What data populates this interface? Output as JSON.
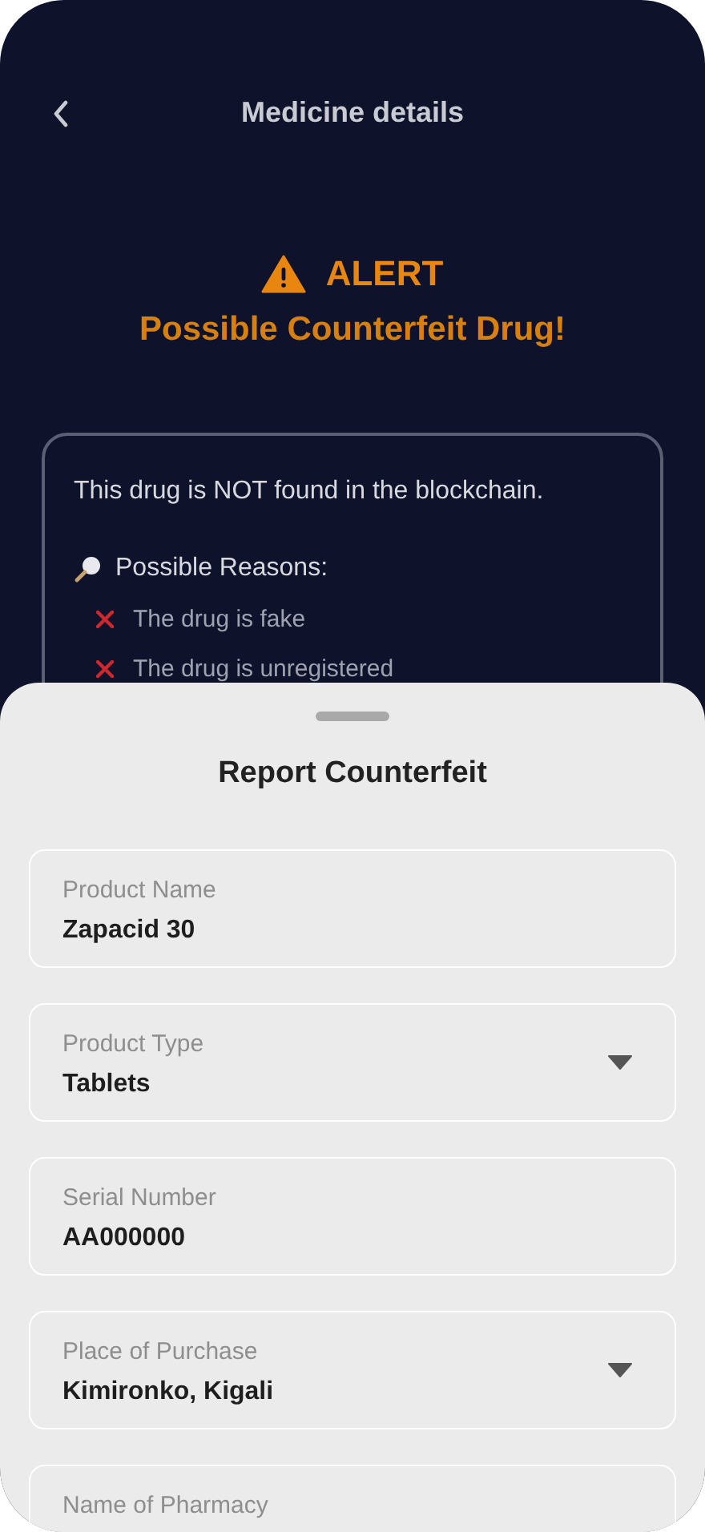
{
  "header": {
    "title": "Medicine details"
  },
  "alert": {
    "label": "ALERT",
    "message": "Possible Counterfeit Drug!"
  },
  "result_card": {
    "statement": "This drug is NOT found in the blockchain.",
    "reasons_heading": "Possible Reasons:",
    "reasons": [
      "The drug is fake",
      "The drug is unregistered"
    ]
  },
  "sheet": {
    "title": "Report Counterfeit",
    "fields": [
      {
        "kind": "text",
        "label": "Product Name",
        "value": "Zapacid 30"
      },
      {
        "kind": "dropdown",
        "label": "Product Type",
        "value": "Tablets"
      },
      {
        "kind": "text",
        "label": "Serial Number",
        "value": "AA000000"
      },
      {
        "kind": "dropdown",
        "label": "Place of Purchase",
        "value": "Kimironko, Kigali"
      },
      {
        "kind": "text",
        "label": "Name of Pharmacy"
      }
    ]
  }
}
